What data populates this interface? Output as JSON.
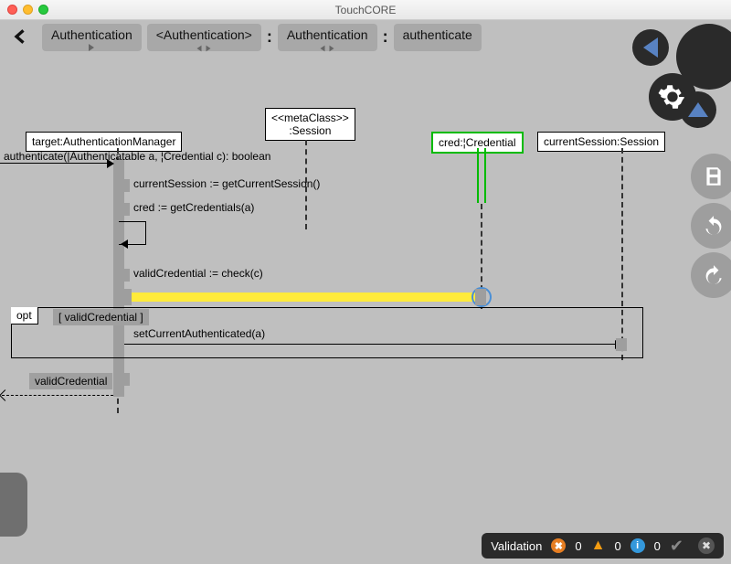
{
  "window": {
    "title": "TouchCORE"
  },
  "breadcrumb": {
    "items": [
      {
        "label": "Authentication"
      },
      {
        "label": "<Authentication>"
      },
      {
        "label": "Authentication"
      },
      {
        "label": "authenticate"
      }
    ],
    "sep": ":"
  },
  "lifelines": {
    "target": "target:AuthenticationManager",
    "session_stereo": "<<metaClass>>",
    "session": ":Session",
    "cred": "cred:¦Credential",
    "currentSession": "currentSession:Session"
  },
  "messages": {
    "authenticate": "authenticate(|Authenticatable a, ¦Credential c): boolean",
    "getCurrentSession": "currentSession := getCurrentSession()",
    "getCredentials": "cred := getCredentials(a)",
    "check": "validCredential := check(c)",
    "setAuth": "setCurrentAuthenticated(a)",
    "return": "validCredential"
  },
  "fragment": {
    "opt": "opt",
    "guard": "[ validCredential ]"
  },
  "status": {
    "label": "Validation",
    "errors": "0",
    "warnings": "0",
    "infos": "0"
  }
}
